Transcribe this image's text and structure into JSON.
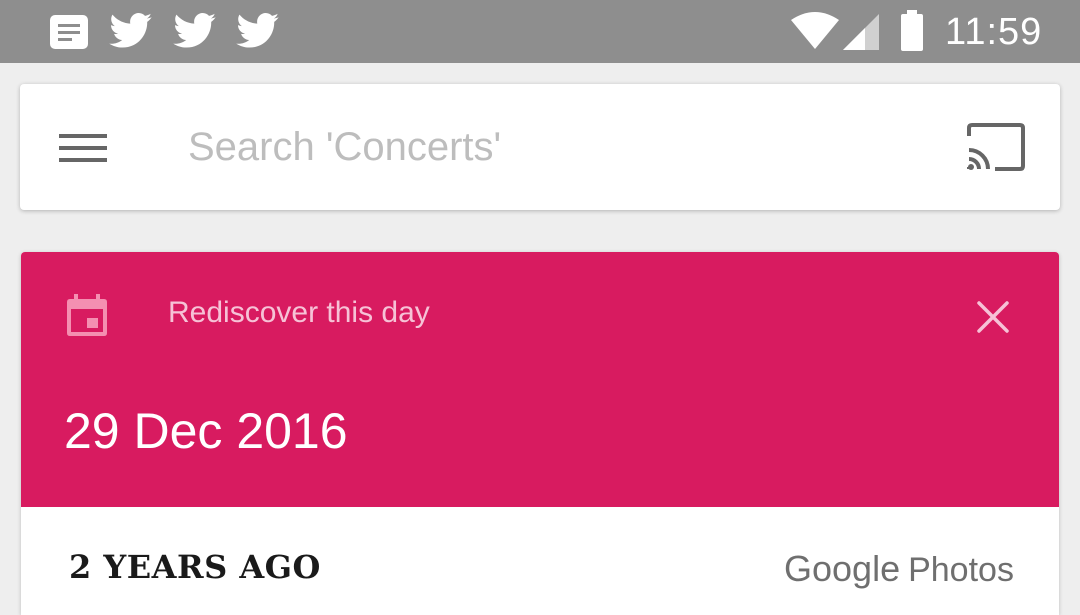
{
  "status_bar": {
    "notification_icons": [
      "news-icon",
      "twitter-icon",
      "twitter-icon",
      "twitter-icon"
    ],
    "system_icons": [
      "wifi-icon",
      "cell-signal-icon",
      "battery-icon"
    ],
    "time": "11:59",
    "background_color": "#8e8e8e"
  },
  "search": {
    "menu_icon": "hamburger-menu-icon",
    "placeholder": "Search 'Concerts'",
    "value": "",
    "cast_icon": "cast-icon"
  },
  "card": {
    "icon": "calendar-icon",
    "title": "Rediscover this day",
    "close_icon": "close-icon",
    "date": "29 Dec 2016",
    "header_color": "#d81b60",
    "subtitle": "2 YEARS AGO",
    "brand_primary": "Google",
    "brand_secondary": "Photos"
  }
}
